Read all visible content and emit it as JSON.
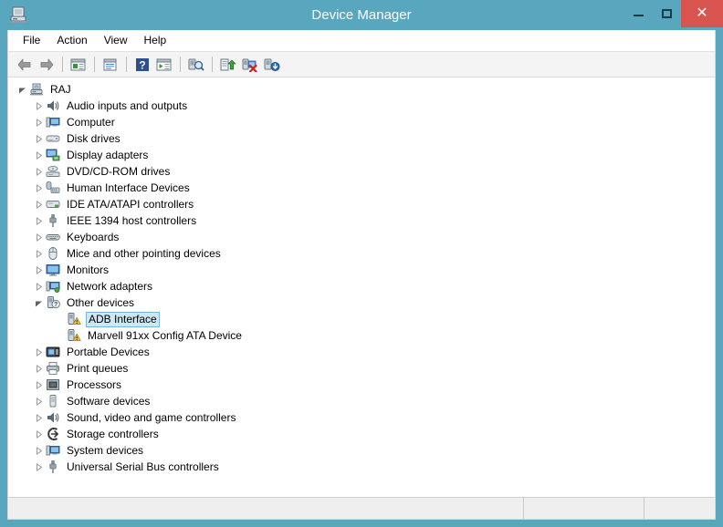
{
  "window": {
    "title": "Device Manager",
    "icon": "device-manager-icon",
    "accent_color": "#58a7bf",
    "close_color": "#d9534f",
    "caption": {
      "minimize_label": "–",
      "maximize_label": "□",
      "close_label": "✕"
    }
  },
  "menubar": {
    "items": [
      {
        "label": "File"
      },
      {
        "label": "Action"
      },
      {
        "label": "View"
      },
      {
        "label": "Help"
      }
    ]
  },
  "toolbar": {
    "buttons": [
      {
        "name": "back-button",
        "icon": "back-arrow-icon",
        "enabled": true
      },
      {
        "name": "forward-button",
        "icon": "forward-arrow-icon",
        "enabled": true
      },
      {
        "name": "separator-1",
        "icon": "separator"
      },
      {
        "name": "show-hide-console-tree-button",
        "icon": "console-tree-icon"
      },
      {
        "name": "separator-2",
        "icon": "separator"
      },
      {
        "name": "properties-button",
        "icon": "properties-icon"
      },
      {
        "name": "separator-3",
        "icon": "separator"
      },
      {
        "name": "help-button",
        "icon": "help-question-icon"
      },
      {
        "name": "show-hide-action-pane-button",
        "icon": "action-pane-icon"
      },
      {
        "name": "separator-4",
        "icon": "separator"
      },
      {
        "name": "scan-for-hardware-changes-button",
        "icon": "scan-hardware-icon"
      },
      {
        "name": "separator-5",
        "icon": "separator"
      },
      {
        "name": "update-driver-button",
        "icon": "update-driver-icon"
      },
      {
        "name": "uninstall-device-button",
        "icon": "uninstall-device-icon"
      },
      {
        "name": "disable-device-button",
        "icon": "disable-device-icon"
      }
    ]
  },
  "tree": {
    "nodes": [
      {
        "label": "RAJ",
        "depth": 0,
        "icon": "computer-root-icon",
        "state": "expanded",
        "selected": false
      },
      {
        "label": "Audio inputs and outputs",
        "depth": 1,
        "icon": "speaker-icon",
        "state": "collapsed",
        "selected": false
      },
      {
        "label": "Computer",
        "depth": 1,
        "icon": "computer-icon",
        "state": "collapsed",
        "selected": false
      },
      {
        "label": "Disk drives",
        "depth": 1,
        "icon": "disk-drive-icon",
        "state": "collapsed",
        "selected": false
      },
      {
        "label": "Display adapters",
        "depth": 1,
        "icon": "display-adapter-icon",
        "state": "collapsed",
        "selected": false
      },
      {
        "label": "DVD/CD-ROM drives",
        "depth": 1,
        "icon": "dvd-drive-icon",
        "state": "collapsed",
        "selected": false
      },
      {
        "label": "Human Interface Devices",
        "depth": 1,
        "icon": "hid-icon",
        "state": "collapsed",
        "selected": false
      },
      {
        "label": "IDE ATA/ATAPI controllers",
        "depth": 1,
        "icon": "ide-controller-icon",
        "state": "collapsed",
        "selected": false
      },
      {
        "label": "IEEE 1394 host controllers",
        "depth": 1,
        "icon": "ieee1394-icon",
        "state": "collapsed",
        "selected": false
      },
      {
        "label": "Keyboards",
        "depth": 1,
        "icon": "keyboard-icon",
        "state": "collapsed",
        "selected": false
      },
      {
        "label": "Mice and other pointing devices",
        "depth": 1,
        "icon": "mouse-icon",
        "state": "collapsed",
        "selected": false
      },
      {
        "label": "Monitors",
        "depth": 1,
        "icon": "monitor-icon",
        "state": "collapsed",
        "selected": false
      },
      {
        "label": "Network adapters",
        "depth": 1,
        "icon": "network-adapter-icon",
        "state": "collapsed",
        "selected": false
      },
      {
        "label": "Other devices",
        "depth": 1,
        "icon": "other-device-question-icon",
        "state": "expanded",
        "selected": false
      },
      {
        "label": "ADB Interface",
        "depth": 2,
        "icon": "unknown-device-warning-icon",
        "state": "leaf",
        "selected": true
      },
      {
        "label": "Marvell 91xx Config ATA Device",
        "depth": 2,
        "icon": "unknown-device-warning-icon",
        "state": "leaf",
        "selected": false
      },
      {
        "label": "Portable Devices",
        "depth": 1,
        "icon": "portable-device-icon",
        "state": "collapsed",
        "selected": false
      },
      {
        "label": "Print queues",
        "depth": 1,
        "icon": "printer-icon",
        "state": "collapsed",
        "selected": false
      },
      {
        "label": "Processors",
        "depth": 1,
        "icon": "processor-icon",
        "state": "collapsed",
        "selected": false
      },
      {
        "label": "Software devices",
        "depth": 1,
        "icon": "software-device-icon",
        "state": "collapsed",
        "selected": false
      },
      {
        "label": "Sound, video and game controllers",
        "depth": 1,
        "icon": "speaker-icon",
        "state": "collapsed",
        "selected": false
      },
      {
        "label": "Storage controllers",
        "depth": 1,
        "icon": "storage-controller-icon",
        "state": "collapsed",
        "selected": false
      },
      {
        "label": "System devices",
        "depth": 1,
        "icon": "computer-icon",
        "state": "collapsed",
        "selected": false
      },
      {
        "label": "Universal Serial Bus controllers",
        "depth": 1,
        "icon": "usb-icon",
        "state": "collapsed",
        "selected": false
      }
    ]
  },
  "statusbar": {
    "main_text": "",
    "second_text": "",
    "third_text": ""
  }
}
